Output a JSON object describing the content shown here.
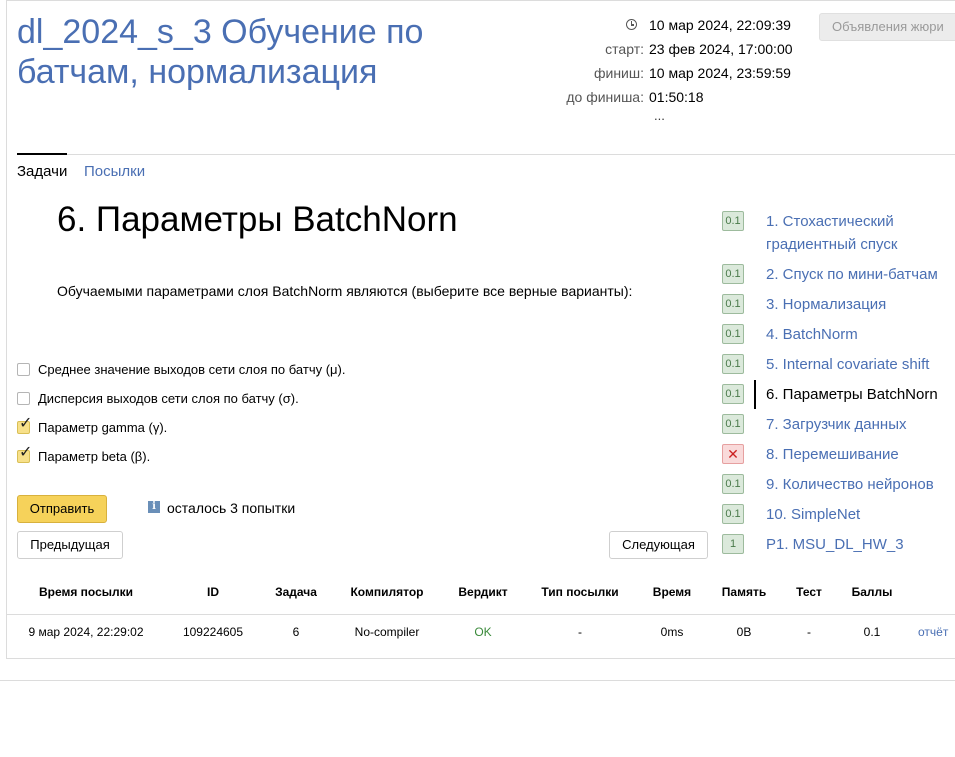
{
  "contest": {
    "title": "dl_2024_s_3 Обучение по батчам, нормализация",
    "current_time": "10 мар 2024, 22:09:39",
    "start_label": "старт:",
    "start_value": "23 фев 2024, 17:00:00",
    "finish_label": "финиш:",
    "finish_value": "10 мар 2024, 23:59:59",
    "remaining_label": "до финиша:",
    "remaining_value": "01:50:18",
    "more": "...",
    "jury_button": "Объявления жюри"
  },
  "tabs": {
    "problems": "Задачи",
    "submissions": "Посылки"
  },
  "problem": {
    "title": "6. Параметры BatchNorn",
    "statement": "Обучаемыми параметрами слоя BatchNorm являются (выберите все верные варианты):",
    "options": [
      {
        "label": "Среднее значение выходов сети слоя по батчу (μ).",
        "checked": false
      },
      {
        "label": "Дисперсия выходов сети слоя по батчу (σ).",
        "checked": false
      },
      {
        "label": "Параметр gamma (γ).",
        "checked": true
      },
      {
        "label": "Параметр beta (β).",
        "checked": true
      }
    ],
    "submit_button": "Отправить",
    "attempts_text": "осталось 3 попытки",
    "prev_button": "Предыдущая",
    "next_button": "Следующая"
  },
  "problem_list": [
    {
      "badge": "0.1",
      "label": "1. Стохастический градиентный спуск",
      "status": "ok"
    },
    {
      "badge": "0.1",
      "label": "2. Спуск по мини-батчам",
      "status": "ok"
    },
    {
      "badge": "0.1",
      "label": "3. Нормализация",
      "status": "ok"
    },
    {
      "badge": "0.1",
      "label": "4. BatchNorm",
      "status": "ok"
    },
    {
      "badge": "0.1",
      "label": "5. Internal covariate shift",
      "status": "ok"
    },
    {
      "badge": "0.1",
      "label": "6. Параметры BatchNorn",
      "status": "ok",
      "active": true
    },
    {
      "badge": "0.1",
      "label": "7. Загрузчик данных",
      "status": "ok"
    },
    {
      "badge": "✕",
      "label": "8. Перемешивание",
      "status": "fail"
    },
    {
      "badge": "0.1",
      "label": "9. Количество нейронов",
      "status": "ok"
    },
    {
      "badge": "0.1",
      "label": "10. SimpleNet",
      "status": "ok"
    },
    {
      "badge": "1",
      "label": "P1. MSU_DL_HW_3",
      "status": "ok"
    }
  ],
  "submissions_table": {
    "headers": [
      "Время посылки",
      "ID",
      "Задача",
      "Компилятор",
      "Вердикт",
      "Тип посылки",
      "Время",
      "Память",
      "Тест",
      "Баллы"
    ],
    "rows": [
      [
        "9 мар 2024, 22:29:02",
        "109224605",
        "6",
        "No-compiler",
        "OK",
        "-",
        "0ms",
        "0B",
        "-",
        "0.1",
        "отчёт"
      ]
    ]
  },
  "colors": {
    "link": "#4a6fb3",
    "accent_button": "#f6d25a",
    "ok_verdict": "#3a8a3a",
    "badge_ok_bg": "#dbe9db",
    "badge_fail_bg": "#f9dada"
  }
}
